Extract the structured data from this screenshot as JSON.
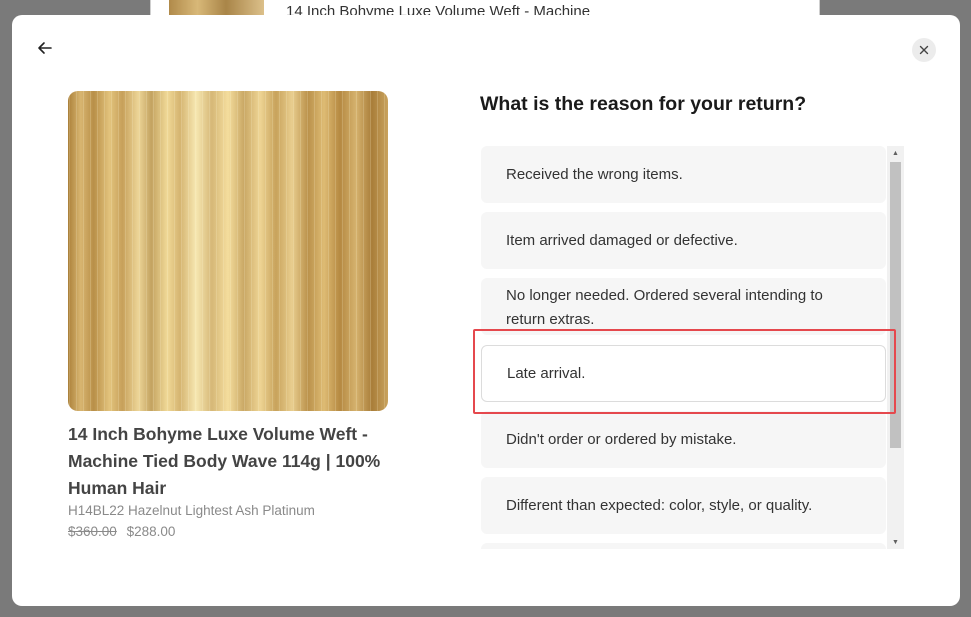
{
  "background": {
    "partial_title": "14 Inch Bohyme Luxe Volume Weft - Machine"
  },
  "modal": {
    "back_icon": "arrow-left-icon",
    "close_icon": "close-icon"
  },
  "product": {
    "name": "14 Inch Bohyme Luxe Volume Weft - Machine Tied Body Wave 114g | 100% Human Hair",
    "variant": "H14BL22 Hazelnut Lightest Ash Platinum",
    "price_original": "$360.00",
    "price_sale": "$288.00"
  },
  "return_form": {
    "question": "What is the reason for your return?",
    "reasons": [
      {
        "label": "Received the wrong items."
      },
      {
        "label": "Item arrived damaged or defective."
      },
      {
        "label": "No longer needed. Ordered several intending to return extras."
      },
      {
        "label": "Late arrival."
      },
      {
        "label": "Didn't order or ordered by mistake."
      },
      {
        "label": "Different than expected: color, style, or quality."
      },
      {
        "label": ""
      }
    ],
    "highlighted_reason": "Late arrival."
  },
  "colors": {
    "highlight": "#e5484d",
    "reason_bg": "#f6f6f6"
  }
}
